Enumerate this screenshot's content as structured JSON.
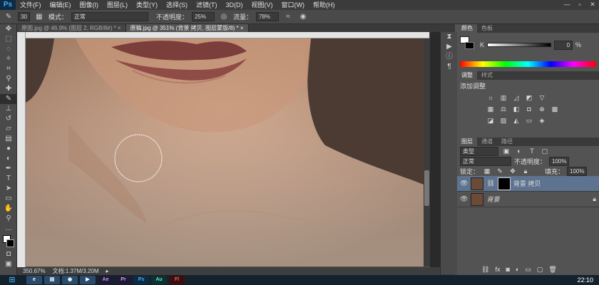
{
  "app": {
    "logo": "Ps"
  },
  "menu": [
    "文件(F)",
    "编辑(E)",
    "图像(I)",
    "图层(L)",
    "类型(Y)",
    "选择(S)",
    "滤镜(T)",
    "3D(D)",
    "视图(V)",
    "窗口(W)",
    "帮助(H)"
  ],
  "window_controls": {
    "minimize": "—",
    "restore": "▫",
    "close": "✕"
  },
  "options": {
    "brush_size": "30",
    "mode_label": "模式：",
    "mode_value": "正常",
    "opacity_label": "不透明度：",
    "opacity_value": "25%",
    "flow_label": "流量：",
    "flow_value": "78%"
  },
  "tabs": [
    {
      "label": "原图.jpg @ 46.9% (图层 2, RGB/8#) *",
      "close": "×"
    },
    {
      "label": "原稿.jpg @ 351% (背景 拷贝, 图层蒙版/8) *",
      "close": "×"
    }
  ],
  "status": {
    "zoom": "350.67%",
    "doc": "文档:1.37M/3.20M"
  },
  "panels": {
    "color_tabs": [
      "颜色",
      "色板"
    ],
    "color_channel": "K",
    "color_value": "0",
    "color_unit": "%",
    "adjust_tabs": [
      "调整",
      "样式"
    ],
    "adjust_title": "添加调整",
    "layers_tabs": [
      "图层",
      "通道",
      "路径"
    ],
    "filter_kind": "类型",
    "blend_mode": "正常",
    "opacity_label": "不透明度：",
    "opacity_value": "100%",
    "lock_label": "锁定：",
    "fill_label": "填充：",
    "fill_value": "100%",
    "layers": [
      {
        "name": "背景 拷贝",
        "selected": true
      },
      {
        "name": "背景",
        "selected": false
      }
    ],
    "footer_icons": [
      "fx"
    ]
  },
  "taskbar": {
    "apps": [
      "Ae",
      "Pr",
      "Ps",
      "Au",
      "Fl"
    ],
    "clock": "22:10"
  },
  "colors": {
    "ps_blue": "#3ab4f2",
    "selection": "#5e7390"
  }
}
